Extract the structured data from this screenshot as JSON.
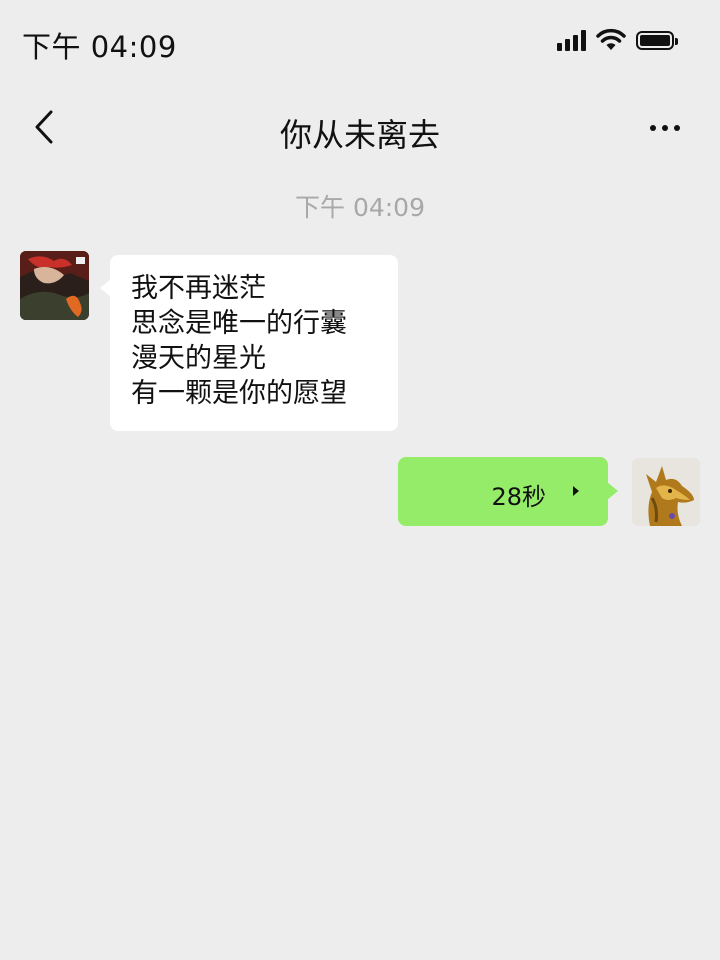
{
  "status_bar": {
    "time": "下午 04:09",
    "icons": [
      "signal-icon",
      "wifi-icon",
      "battery-icon"
    ]
  },
  "nav": {
    "title": "你从未离去",
    "back_icon": "chevron-left-icon",
    "more_icon": "more-dots-icon"
  },
  "chat": {
    "timestamp": "下午 04:09",
    "messages": [
      {
        "side": "left",
        "type": "text",
        "lines": [
          "我不再迷茫",
          "思念是唯一的行囊",
          "漫天的星光",
          "有一颗是你的愿望"
        ]
      },
      {
        "side": "right",
        "type": "voice",
        "duration": "28秒"
      }
    ]
  },
  "colors": {
    "background": "#ededed",
    "incoming_bubble": "#ffffff",
    "outgoing_bubble": "#95ec69",
    "timestamp_text": "#a8a8a8"
  }
}
